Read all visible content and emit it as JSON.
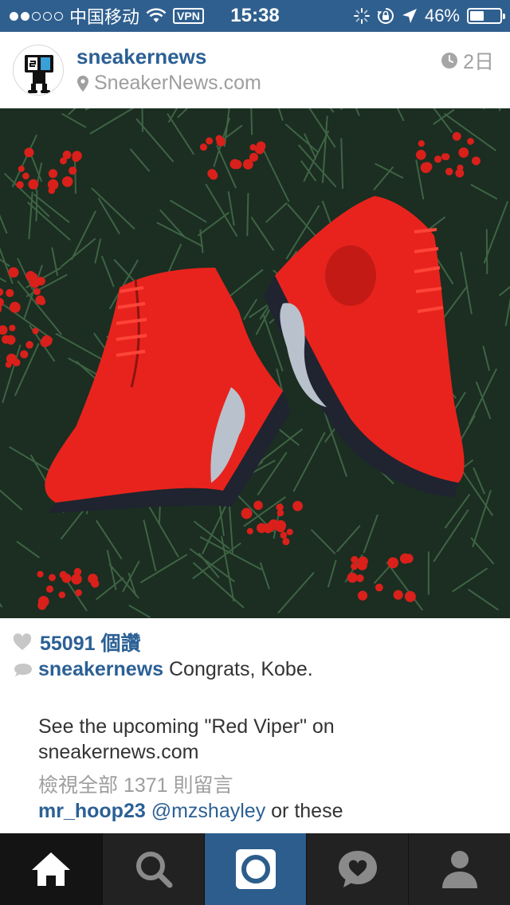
{
  "status_bar": {
    "carrier": "中国移动",
    "vpn": "VPN",
    "time": "15:38",
    "battery": "46%",
    "battery_level": 0.46
  },
  "post": {
    "username": "sneakernews",
    "location": "SneakerNews.com",
    "time_ago": "2日",
    "likes_count": "55091",
    "likes_suffix": "個讚",
    "caption_user": "sneakernews",
    "caption_first_line": "Congrats, Kobe.",
    "caption_body_1": "See the upcoming \"Red Viper\" on",
    "caption_body_2": "sneakernews.com",
    "view_all_comments": "檢視全部 1371 則留言",
    "top_comment": {
      "user": "mr_hoop23",
      "mention": "@mzshayley",
      "text": "or these"
    }
  },
  "tab_bar": {
    "tabs": [
      "home-icon",
      "search-icon",
      "camera-icon",
      "activity-icon",
      "profile-icon"
    ],
    "active": "home"
  },
  "colors": {
    "status_bar": "#2f5f8e",
    "link_blue": "#2b6095",
    "camera_tab": "#2c5d8c",
    "tab_bar": "#222222"
  }
}
